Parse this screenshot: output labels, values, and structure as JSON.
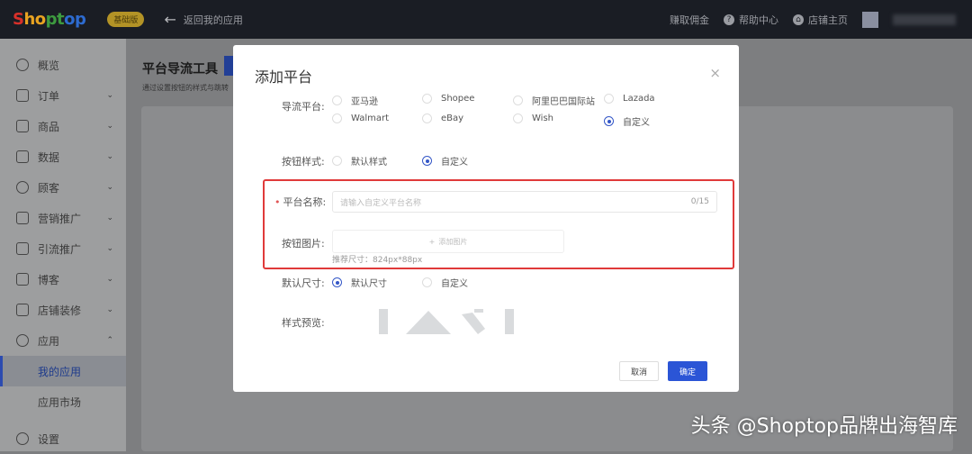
{
  "header": {
    "logo": [
      "S",
      "ho",
      "pt",
      "op"
    ],
    "badge": "基础版",
    "back": "返回我的应用",
    "earn": "赚取佣金",
    "help": "帮助中心",
    "store": "店铺主页"
  },
  "sidebar": {
    "items": [
      {
        "label": "概览"
      },
      {
        "label": "订单"
      },
      {
        "label": "商品"
      },
      {
        "label": "数据"
      },
      {
        "label": "顾客"
      },
      {
        "label": "营销推广"
      },
      {
        "label": "引流推广"
      },
      {
        "label": "博客"
      },
      {
        "label": "店铺装修"
      },
      {
        "label": "应用"
      }
    ],
    "sub": [
      "我的应用",
      "应用市场"
    ],
    "settings": "设置"
  },
  "main": {
    "title": "平台导流工具",
    "subtitle": "通过设置按钮的样式与跳转"
  },
  "modal": {
    "title": "添加平台",
    "close": "×",
    "platform_label": "导流平台:",
    "platforms": [
      "亚马逊",
      "Shopee",
      "阿里巴巴国际站",
      "Lazada",
      "Walmart",
      "eBay",
      "Wish",
      "自定义"
    ],
    "style_label": "按钮样式:",
    "styles": [
      "默认样式",
      "自定义"
    ],
    "name_label": "平台名称:",
    "name_placeholder": "请输入自定义平台名称",
    "name_count": "0/15",
    "image_label": "按钮图片:",
    "image_add": "添加图片",
    "image_hint": "推荐尺寸：824px*88px",
    "size_label": "默认尺寸:",
    "sizes": [
      "默认尺寸",
      "自定义"
    ],
    "preview_label": "样式预览:",
    "cancel": "取消",
    "ok": "确定"
  },
  "watermark": "头条 @Shoptop品牌出海智库"
}
